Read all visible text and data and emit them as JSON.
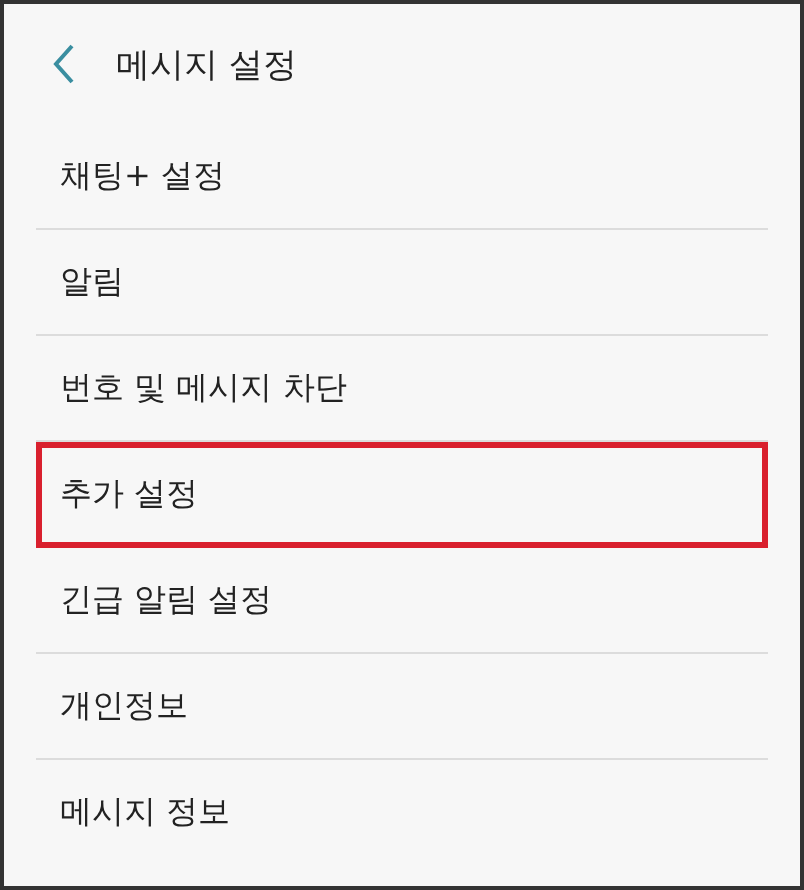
{
  "header": {
    "title": "메시지 설정"
  },
  "items": [
    {
      "label": "채팅+ 설정",
      "highlighted": false
    },
    {
      "label": "알림",
      "highlighted": false
    },
    {
      "label": "번호 및 메시지 차단",
      "highlighted": false
    },
    {
      "label": "추가 설정",
      "highlighted": true
    },
    {
      "label": "긴급 알림 설정",
      "highlighted": false
    },
    {
      "label": "개인정보",
      "highlighted": false
    },
    {
      "label": "메시지 정보",
      "highlighted": false
    }
  ]
}
